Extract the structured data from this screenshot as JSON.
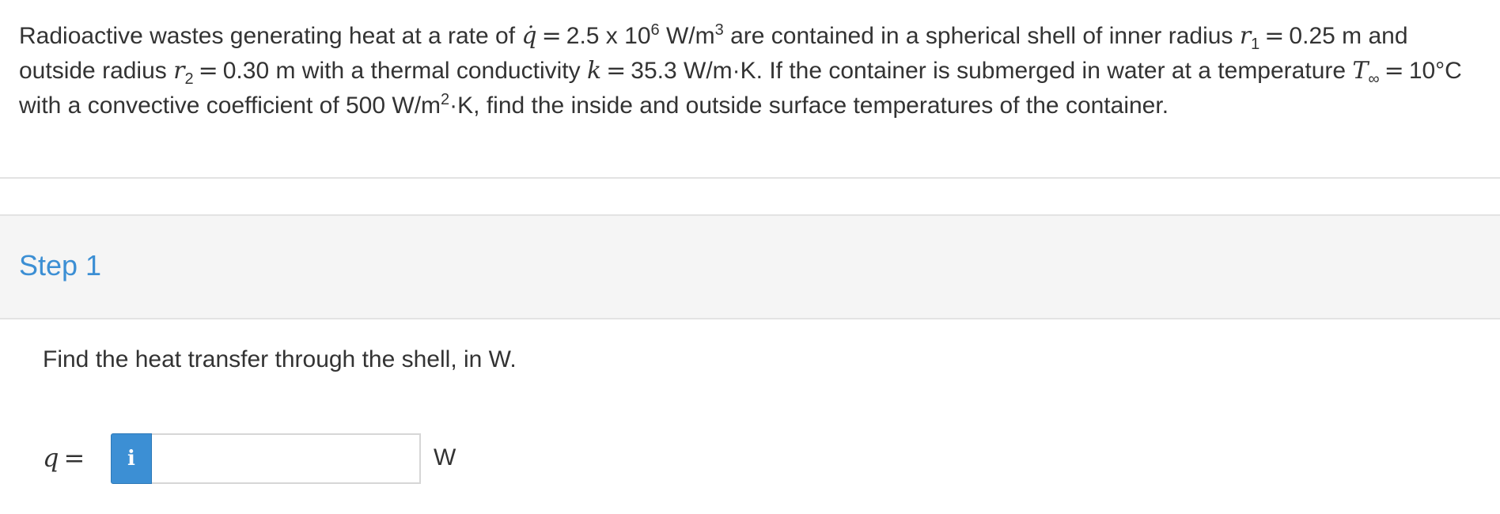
{
  "problem": {
    "t1": "Radioactive wastes generating heat at a rate of",
    "qdot": "q̇",
    "eq": "=",
    "t2": "2.5 x 10",
    "exp6": "6",
    "t3": " W/m",
    "exp3": "3",
    "t4": " are contained in a spherical shell of inner radius",
    "r": "r",
    "sub1": "1",
    "t5": "0.25 m and outside radius",
    "sub2": "2",
    "t6": "0.30 m with a thermal conductivity",
    "k": "k",
    "t7": "35.3 W/m·K. If the container is submerged in water at a temperature",
    "T": "T",
    "inf": "∞",
    "t8": "10°C with a convective coefficient of 500 W/m",
    "exp2": "2",
    "t9": "·K, find the inside and outside surface temperatures of the container."
  },
  "step": {
    "title": "Step 1"
  },
  "question": {
    "text": "Find the heat transfer through the shell, in W."
  },
  "answer": {
    "label_var": "q",
    "label_eq": "=",
    "info_icon": "i",
    "value": "",
    "placeholder": "",
    "unit": "W"
  },
  "colors": {
    "accent": "#3c8fd4",
    "text": "#333333",
    "band": "#f5f5f5"
  }
}
